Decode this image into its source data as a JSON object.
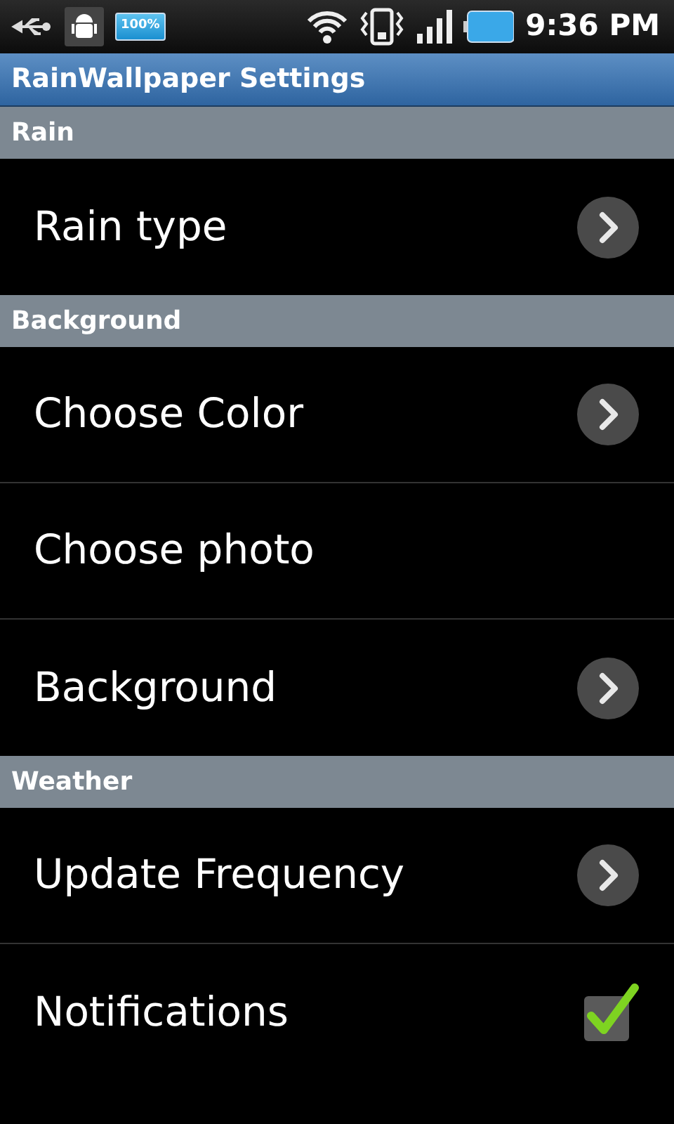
{
  "status_bar": {
    "battery_badge": "100%",
    "time": "9:36 PM"
  },
  "title": "RainWallpaper Settings",
  "sections": [
    {
      "header": "Rain",
      "items": [
        {
          "label": "Rain type",
          "kind": "chevron"
        }
      ]
    },
    {
      "header": "Background",
      "items": [
        {
          "label": "Choose Color",
          "kind": "chevron"
        },
        {
          "label": "Choose photo",
          "kind": "plain"
        },
        {
          "label": "Background",
          "kind": "chevron"
        }
      ]
    },
    {
      "header": "Weather",
      "items": [
        {
          "label": "Update Frequency",
          "kind": "chevron"
        },
        {
          "label": "Notifications",
          "kind": "checkbox",
          "checked": true
        }
      ]
    }
  ]
}
